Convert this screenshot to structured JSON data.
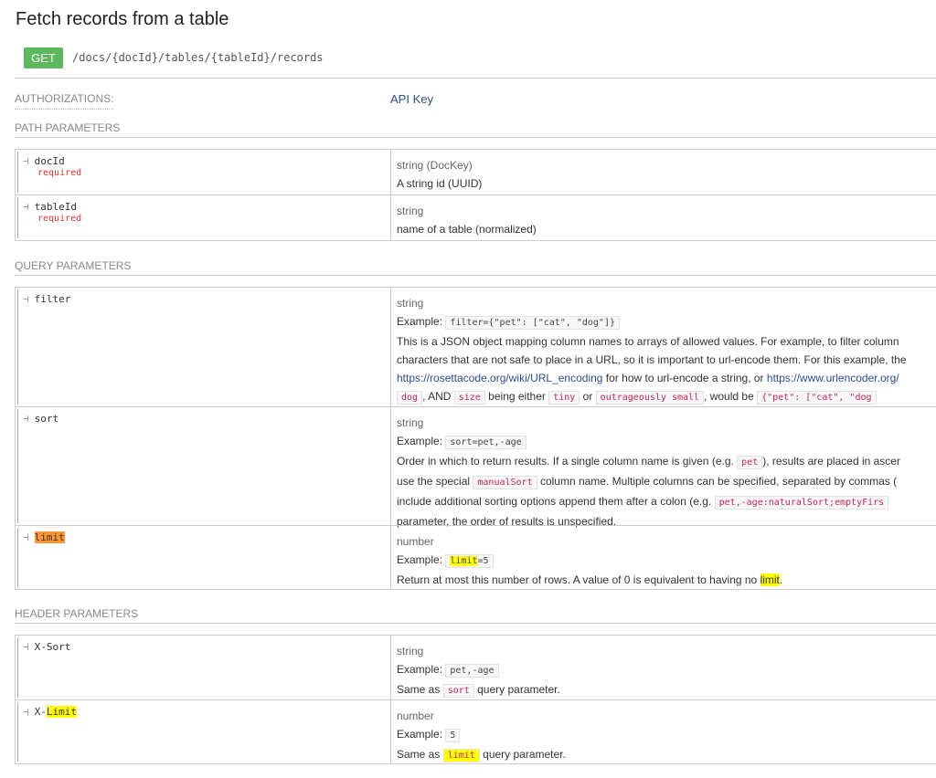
{
  "title": "Fetch records from a table",
  "method": "GET",
  "path": "/docs/{docId}/tables/{tableId}/records",
  "auth": {
    "label": "AUTHORIZATIONS:",
    "value": "API Key"
  },
  "sections": {
    "path": "PATH PARAMETERS",
    "query": "QUERY PARAMETERS",
    "header": "HEADER PARAMETERS"
  },
  "path_params": [
    {
      "name": "docId",
      "required": "required",
      "type": "string (DocKey)",
      "desc": "A string id (UUID)"
    },
    {
      "name": "tableId",
      "required": "required",
      "type": "string",
      "desc": "name of a table (normalized)"
    }
  ],
  "filter": {
    "name": "filter",
    "type": "string",
    "example_label": "Example:",
    "example": "filter={\"pet\": [\"cat\", \"dog\"]}",
    "line1": "This is a JSON object mapping column names to arrays of allowed values. For example, to filter column",
    "line2": "characters that are not safe to place in a URL, so it is important to url-encode them. For this example, the",
    "link1": "https://rosettacode.org/wiki/URL_encoding",
    "line3_mid": " for how to url-encode a string, or ",
    "link2": "https://www.urlencoder.org/",
    "c_dog": "dog",
    "and": ", AND ",
    "c_size": "size",
    "being": " being either ",
    "c_tiny": "tiny",
    "or": " or ",
    "c_outr": "outrageously small",
    "would": ", would be ",
    "c_json": "{\"pet\": [\"cat\", \"dog"
  },
  "sort": {
    "name": "sort",
    "type": "string",
    "example_label": "Example:",
    "example": "sort=pet,-age",
    "l1a": "Order in which to return results. If a single column name is given (e.g. ",
    "c_pet": "pet",
    "l1b": "), results are placed in ascer",
    "l2a": "use the special ",
    "c_manual": "manualSort",
    "l2b": " column name. Multiple columns can be specified, separated by commas (",
    "l3a": "include additional sorting options append them after a colon (e.g. ",
    "c_opts": "pet,-age:naturalSort;emptyFirs",
    "l4": "parameter, the order of results is unspecified."
  },
  "limit": {
    "name": "limit",
    "type": "number",
    "example_label": "Example:",
    "ex_hl": "limit",
    "ex_rest": "=5",
    "desc_a": "Return at most this number of rows. A value of 0 is equivalent to having no ",
    "desc_hl": "limit",
    "desc_b": "."
  },
  "xsort": {
    "name": "X-Sort",
    "type": "string",
    "example_label": "Example:",
    "example": "pet,-age",
    "d_a": "Same as ",
    "c_sort": "sort",
    "d_b": " query parameter."
  },
  "xlimit": {
    "name_a": "X-",
    "name_hl": "Limit",
    "type": "number",
    "example_label": "Example:",
    "example": "5",
    "d_a": "Same as ",
    "c_limit": "limit",
    "d_b": " query parameter."
  },
  "colors": {
    "get": "#5cb85c",
    "link": "#2e4c9a",
    "required": "#e03030",
    "highlight": "#ffff00",
    "highlight_active": "#ff9632"
  }
}
